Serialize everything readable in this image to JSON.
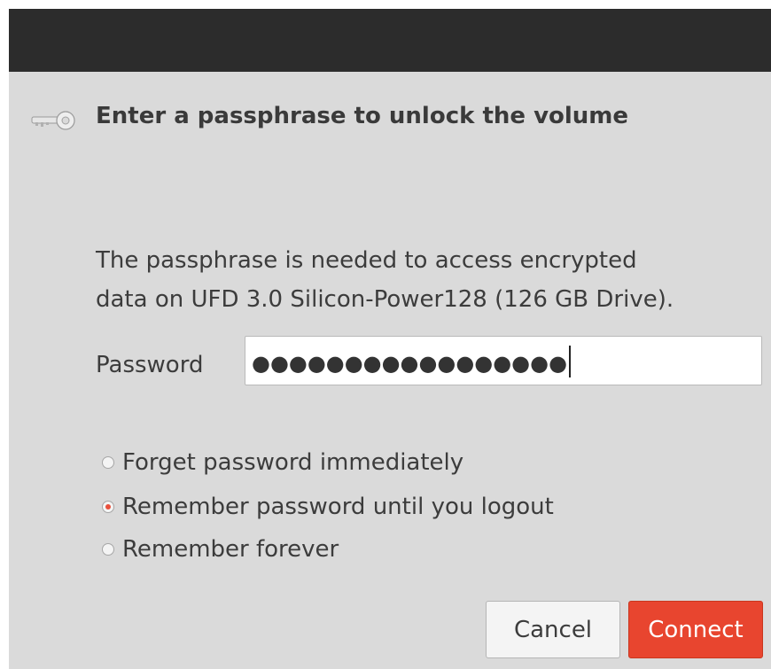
{
  "dialog": {
    "title": "Enter a passphrase to unlock the volume",
    "icon": "key-icon",
    "description_line1": "The passphrase is needed to access encrypted",
    "description_line2": "data on UFD 3.0 Silicon-Power128 (126 GB Drive)."
  },
  "password": {
    "label": "Password",
    "masked_value": "●●●●●●●●●●●●●●●●●"
  },
  "remember_options": [
    {
      "label": "Forget password immediately",
      "selected": false
    },
    {
      "label": "Remember password until you logout",
      "selected": true
    },
    {
      "label": "Remember forever",
      "selected": false
    }
  ],
  "buttons": {
    "cancel_label": "Cancel",
    "connect_label": "Connect"
  },
  "colors": {
    "accent": "#e8452f",
    "titlebar": "#2c2c2c",
    "dialog_bg": "#dadada"
  }
}
